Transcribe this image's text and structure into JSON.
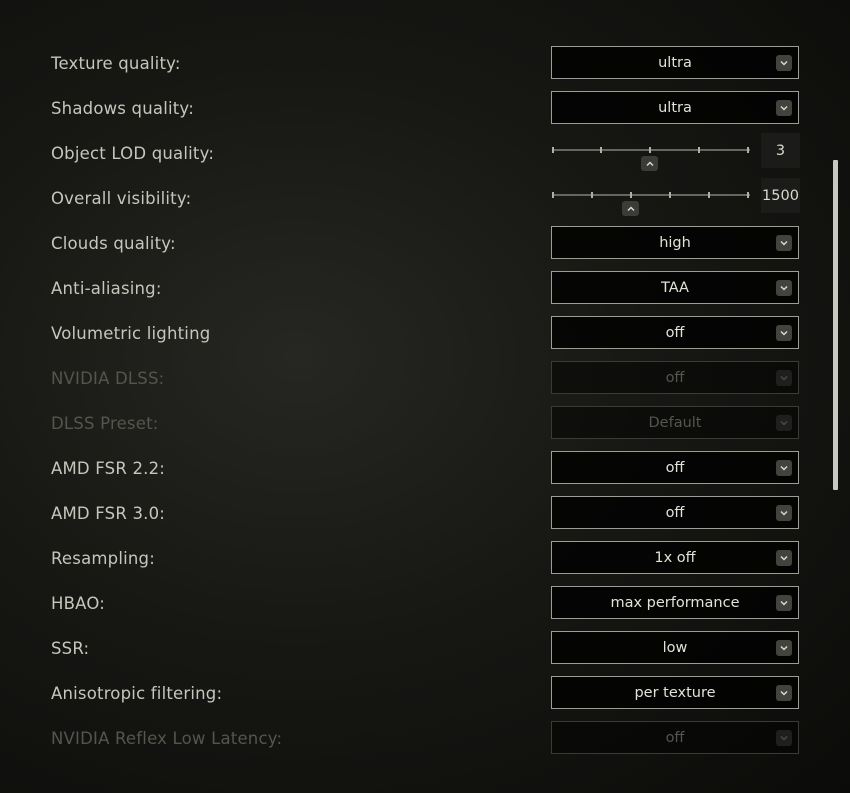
{
  "settings": [
    {
      "label": "Texture quality:",
      "value": "ultra"
    },
    {
      "label": "Shadows quality:",
      "value": "ultra"
    },
    {
      "label": "Object LOD quality:",
      "value": "3",
      "slider_min": 0,
      "slider_max": 4,
      "slider_value": 2
    },
    {
      "label": "Overall visibility:",
      "value": "1500",
      "slider_value_fraction": 0.4
    },
    {
      "label": "Clouds quality:",
      "value": "high"
    },
    {
      "label": "Anti-aliasing:",
      "value": "TAA"
    },
    {
      "label": "Volumetric lighting",
      "value": "off"
    },
    {
      "label": "NVIDIA DLSS:",
      "value": "off",
      "disabled": true
    },
    {
      "label": "DLSS Preset:",
      "value": "Default",
      "disabled": true
    },
    {
      "label": "AMD FSR 2.2:",
      "value": "off"
    },
    {
      "label": "AMD FSR 3.0:",
      "value": "off"
    },
    {
      "label": "Resampling:",
      "value": "1x off"
    },
    {
      "label": "HBAO:",
      "value": "max performance"
    },
    {
      "label": "SSR:",
      "value": "low"
    },
    {
      "label": "Anisotropic filtering:",
      "value": "per texture"
    },
    {
      "label": "NVIDIA Reflex Low Latency:",
      "value": "off",
      "disabled": true
    }
  ],
  "icons": {
    "dropdown": "chevron-down-icon",
    "slider_thumb": "chevron-up-icon"
  },
  "colors": {
    "label": "#c6c6bd",
    "disabled": "#55554f",
    "border": "#9d9d93",
    "value": "#e2e2d8"
  }
}
